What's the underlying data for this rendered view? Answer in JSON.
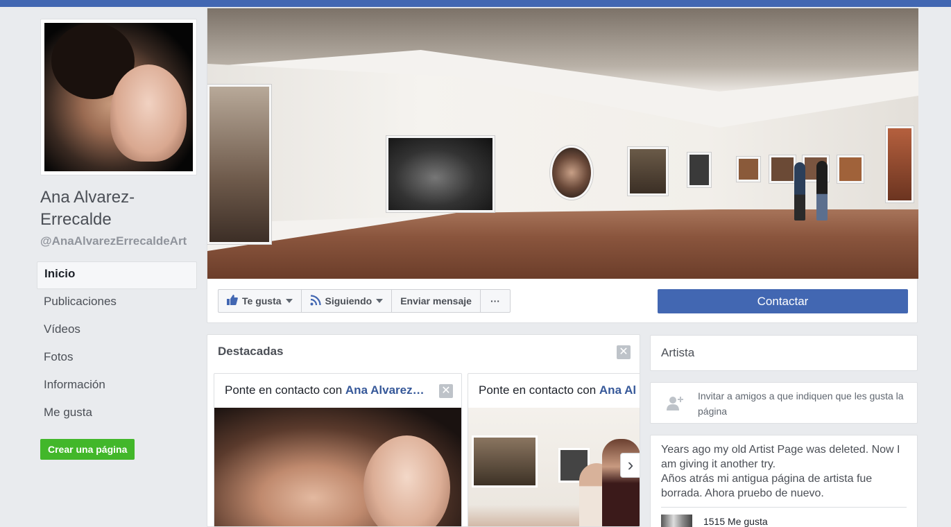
{
  "page": {
    "name": "Ana Alvarez-Errecalde",
    "handle": "@AnaAlvarezErrecaldeArt"
  },
  "nav": {
    "items": [
      {
        "label": "Inicio"
      },
      {
        "label": "Publicaciones"
      },
      {
        "label": "Vídeos"
      },
      {
        "label": "Fotos"
      },
      {
        "label": "Información"
      },
      {
        "label": "Me gusta"
      }
    ],
    "active_index": 0
  },
  "create_page_label": "Crear una página",
  "actions": {
    "like_label": "Te gusta",
    "following_label": "Siguiendo",
    "message_label": "Enviar mensaje",
    "more_label": "···",
    "contact_label": "Contactar"
  },
  "featured": {
    "title": "Destacadas",
    "close_label": "✕",
    "cards": [
      {
        "prefix": "Ponte en contacto con ",
        "link": "Ana Alvarez…"
      },
      {
        "prefix": "Ponte en contacto con ",
        "link": "Ana Al"
      }
    ],
    "next_label": "›"
  },
  "sidebar_right": {
    "category": "Artista",
    "invite_text": "Invitar a amigos a que indiquen que les gusta la página",
    "about_lines": [
      "Years ago my old Artist Page was deleted. Now I am giving it another try.",
      "Años atrás mi antigua página de artista fue borrada. Ahora pruebo de nuevo."
    ],
    "likes_text": "1515 Me gusta"
  },
  "colors": {
    "brand_blue": "#4267b2",
    "link_blue": "#365899",
    "create_green": "#42b72a"
  }
}
